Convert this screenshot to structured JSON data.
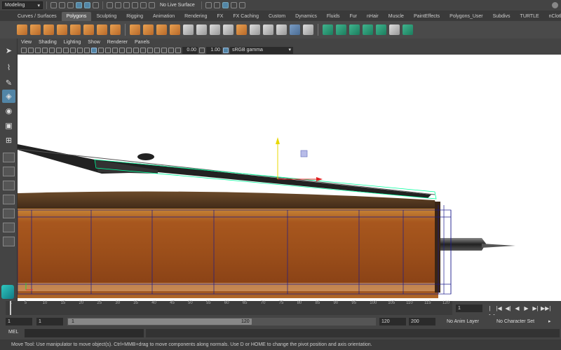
{
  "toolbar": {
    "mode": "Modeling",
    "live_surface": "No Live Surface"
  },
  "shelf": {
    "tabs": [
      "Curves / Surfaces",
      "Polygons",
      "Sculpting",
      "Rigging",
      "Animation",
      "Rendering",
      "FX",
      "FX Caching",
      "Custom",
      "Dynamics",
      "Fluids",
      "Fur",
      "nHair",
      "Muscle",
      "PaintEffects",
      "Polygons_User",
      "Subdivs",
      "TURTLE",
      "nCloth",
      "XG"
    ],
    "active_tab": "Polygons"
  },
  "viewport": {
    "menus": [
      "View",
      "Shading",
      "Lighting",
      "Show",
      "Renderer",
      "Panels"
    ],
    "near_value": "0.00",
    "far_value": "1.00",
    "color_space": "sRGB gamma"
  },
  "timeslider": {
    "ticks": [
      "1",
      "5",
      "10",
      "15",
      "20",
      "25",
      "30",
      "35",
      "40",
      "45",
      "50",
      "55",
      "60",
      "65",
      "70",
      "75",
      "80",
      "85",
      "90",
      "95",
      "100",
      "105",
      "110",
      "115",
      "120"
    ],
    "current_frame": "1",
    "playback": [
      "|◀◀",
      "|◀",
      "◀|",
      "◀",
      "▶",
      "▶|",
      "▶▶|"
    ]
  },
  "range": {
    "start": "1",
    "start2": "1",
    "min": "1",
    "max": "120",
    "end": "120",
    "end2": "200",
    "anim_layer": "No Anim Layer",
    "character_set": "No Character Set"
  },
  "command": {
    "label": "MEL"
  },
  "help_line": "Move Tool: Use manipulator to move object(s). Ctrl+MMB+drag to move components along normals. Use D or HOME to change the pivot position and axis orientation.",
  "colors": {
    "selection": "#5285a6",
    "wireframe": "#00ff9c",
    "manip_x": "#e02020",
    "manip_y": "#e8d800"
  }
}
